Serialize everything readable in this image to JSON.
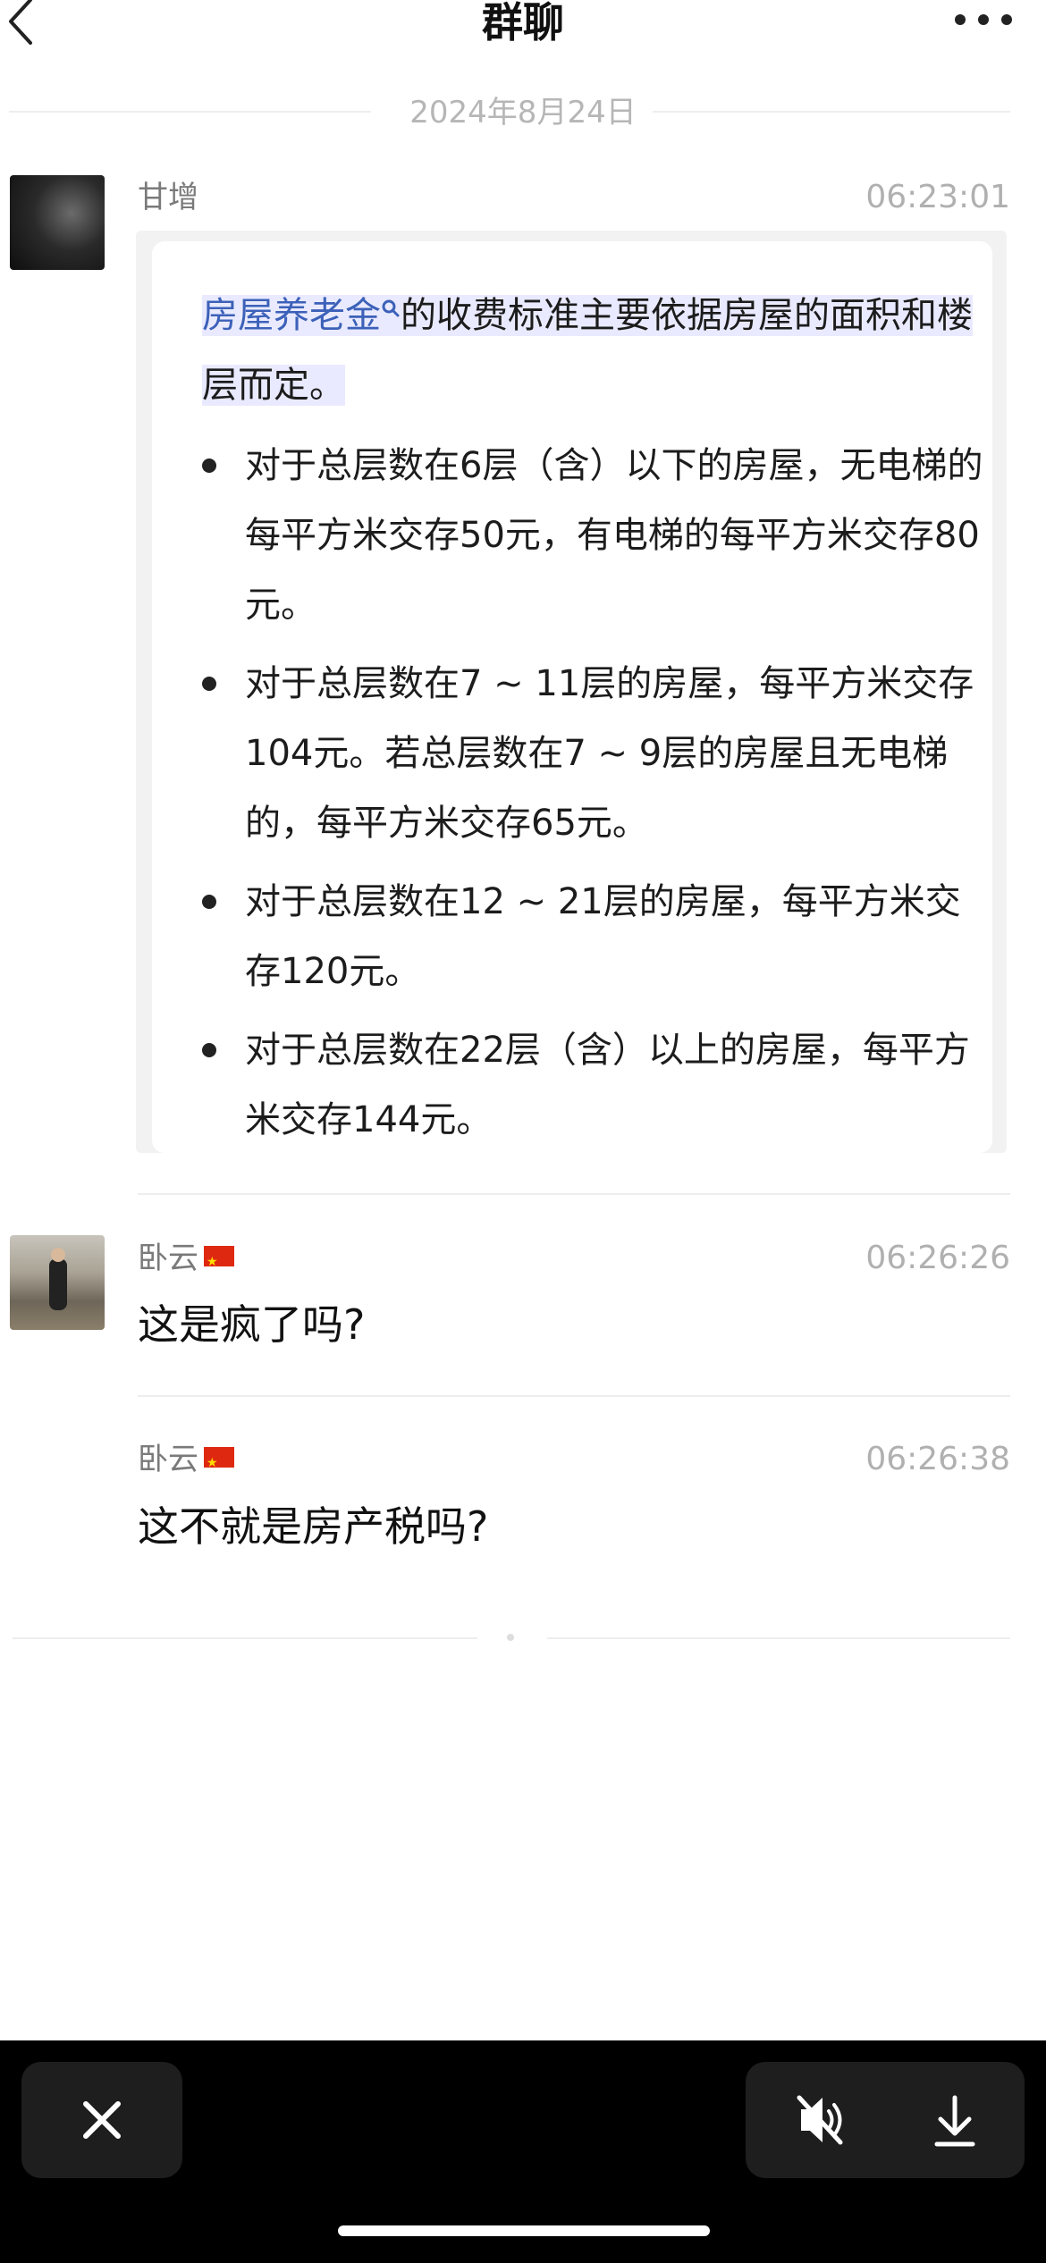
{
  "header": {
    "title": "群聊"
  },
  "date_label": "2024年8月24日",
  "messages": [
    {
      "sender": "甘增",
      "time": "06:23:01",
      "quote": {
        "keyword": "房屋养老金",
        "lead_rest": "的收费标准主要依据房屋的面积和楼层而定。",
        "bullets": [
          "对于总层数在6层（含）以下的房屋，无电梯的每平方米交存50元，有电梯的每平方米交存80元。",
          "对于总层数在7 ~ 11层的房屋，每平方米交存104元。若总层数在7 ~ 9层的房屋且无电梯的，每平方米交存65元。",
          "对于总层数在12 ~ 21层的房屋，每平方米交存120元。",
          "对于总层数在22层（含）以上的房屋，每平方米交存144元。"
        ]
      }
    },
    {
      "sender": "卧云",
      "time": "06:26:26",
      "text": "这是疯了吗?"
    },
    {
      "sender": "卧云",
      "time": "06:26:38",
      "text": "这不就是房产税吗?"
    }
  ],
  "icons": {
    "back": "chevron-left-icon",
    "more": "more-dots-icon",
    "close": "close-icon",
    "mute": "speaker-muted-icon",
    "download": "download-icon",
    "flag": "china-flag-icon"
  },
  "colors": {
    "link": "#3c61b8",
    "highlight": "#e9eaff",
    "bottom_bar": "#000000"
  }
}
